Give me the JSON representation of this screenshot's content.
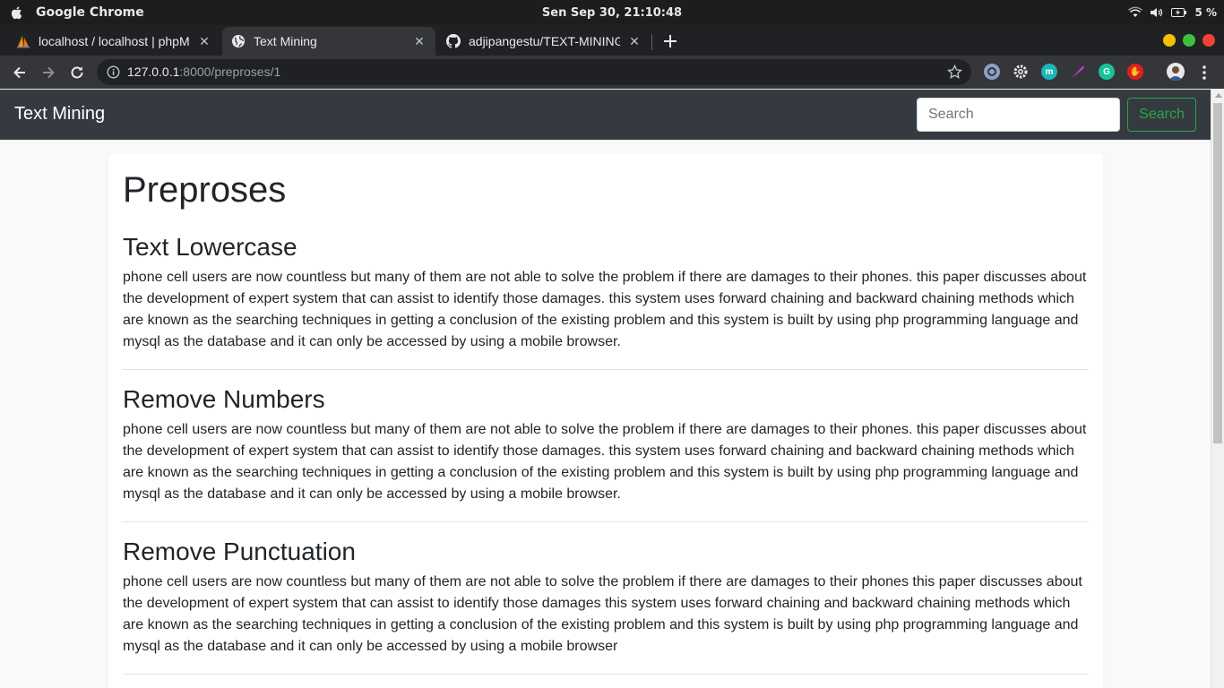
{
  "os": {
    "app_name": "Google Chrome",
    "clock": "Sen Sep 30, 21:10:48",
    "battery": "5 %"
  },
  "browser": {
    "tabs": [
      {
        "title": "localhost / localhost | phpMyAdmin",
        "active": false
      },
      {
        "title": "Text Mining",
        "active": true
      },
      {
        "title": "adjipangestu/TEXT-MINING",
        "active": false
      }
    ],
    "url_host": "127.0.0.1",
    "url_rest": ":8000/preproses/1",
    "extensions": [
      "ghostery-icon",
      "settings-gear-icon",
      "mendeley-icon",
      "feather-icon",
      "grammarly-icon",
      "adblock-hand-icon"
    ]
  },
  "navbar": {
    "brand": "Text Mining",
    "search_placeholder": "Search",
    "search_button": "Search"
  },
  "page": {
    "title": "Preproses",
    "sections": [
      {
        "heading": "Text Lowercase",
        "text": "phone cell users are now countless but many of them are not able to solve the problem if there are damages to their phones. this paper discusses about the development of expert system that can assist to identify those damages. this system uses forward chaining and backward chaining methods which are known as the searching techniques in getting a conclusion of the existing problem and this system is built by using php programming language and mysql as the database and it can only be accessed by using a mobile browser."
      },
      {
        "heading": "Remove Numbers",
        "text": "phone cell users are now countless but many of them are not able to solve the problem if there are damages to their phones. this paper discusses about the development of expert system that can assist to identify those damages. this system uses forward chaining and backward chaining methods which are known as the searching techniques in getting a conclusion of the existing problem and this system is built by using php programming language and mysql as the database and it can only be accessed by using a mobile browser."
      },
      {
        "heading": "Remove Punctuation",
        "text": "phone cell users are now countless but many of them are not able to solve the problem if there are damages to their phones this paper discusses about the development of expert system that can assist to identify those damages this system uses forward chaining and backward chaining methods which are known as the searching techniques in getting a conclusion of the existing problem and this system is built by using php programming language and mysql as the database and it can only be accessed by using a mobile browser"
      }
    ]
  },
  "colors": {
    "navbar_bg": "#343a40",
    "success": "#28a745",
    "chrome_dark": "#202124",
    "chrome_toolbar": "#35363a"
  }
}
